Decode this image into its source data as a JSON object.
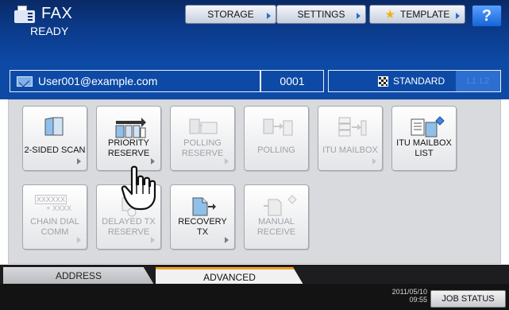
{
  "app": {
    "title": "FAX",
    "status": "READY"
  },
  "top_buttons": {
    "storage": "STORAGE",
    "settings": "SETTINGS",
    "template": "TEMPLATE",
    "help": "?"
  },
  "info": {
    "destination": "User001@example.com",
    "count": "0001",
    "mode": "STANDARD",
    "lines": [
      "L1",
      "L2"
    ]
  },
  "tiles": {
    "two_sided_scan": {
      "label": "2-SIDED SCAN",
      "enabled": true
    },
    "priority_reserve": {
      "label_1": "PRIORITY",
      "label_2": "RESERVE",
      "enabled": true
    },
    "polling_reserve": {
      "label_1": "POLLING",
      "label_2": "RESERVE",
      "enabled": false
    },
    "polling": {
      "label": "POLLING",
      "enabled": false
    },
    "itu_mailbox": {
      "label": "ITU MAILBOX",
      "enabled": false
    },
    "itu_mailbox_list": {
      "label_1": "ITU MAILBOX",
      "label_2": "LIST",
      "enabled": true
    },
    "chain_dial_comm": {
      "label_1": "CHAIN DIAL",
      "label_2": "COMM",
      "icon_top": "XXXXXX",
      "icon_bottom": "+ XXXX",
      "enabled": false
    },
    "delayed_tx_reserve": {
      "label_1": "DELAYED TX",
      "label_2": "RESERVE",
      "enabled": false
    },
    "recovery_tx": {
      "label_1": "RECOVERY",
      "label_2": "TX",
      "enabled": true
    },
    "manual_receive": {
      "label_1": "MANUAL",
      "label_2": "RECEIVE",
      "enabled": false
    }
  },
  "tabs": {
    "address": "ADDRESS",
    "advanced": "ADVANCED",
    "active": "advanced"
  },
  "footer": {
    "date": "2011/05/10",
    "time": "09:55",
    "job_status": "JOB STATUS"
  },
  "colors": {
    "header_blue": "#0d4aa6",
    "accent_orange": "#f0a020",
    "help_blue": "#1565d8"
  }
}
